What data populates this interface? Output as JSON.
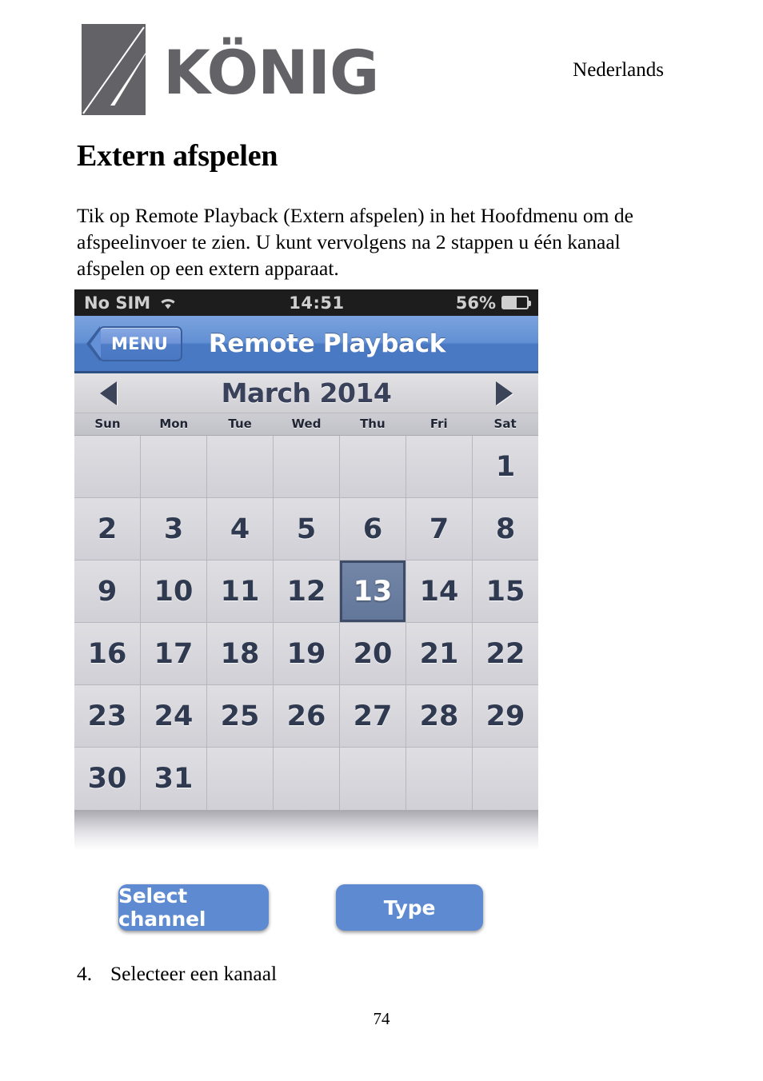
{
  "header": {
    "brand": "KÖNIG",
    "brand_icon": "konig-logo-mark",
    "language": "Nederlands"
  },
  "document": {
    "title": "Extern afspelen",
    "paragraph": "Tik op Remote Playback (Extern afspelen) in het Hoofdmenu om de afspeelinvoer te zien. U kunt vervolgens na 2 stappen u één kanaal afspelen op een extern apparaat.",
    "step": {
      "number": "4.",
      "text": "Selecteer een kanaal"
    },
    "page_number": "74"
  },
  "phone": {
    "status_bar": {
      "carrier": "No SIM",
      "wifi_icon": "wifi-icon",
      "time": "14:51",
      "battery_percent": "56%",
      "battery_icon": "battery-icon",
      "battery_level": 56
    },
    "nav_bar": {
      "back_label": "MENU",
      "title": "Remote Playback"
    },
    "calendar": {
      "prev_icon": "triangle-left-icon",
      "next_icon": "triangle-right-icon",
      "month_label": "March 2014",
      "weekdays": [
        "Sun",
        "Mon",
        "Tue",
        "Wed",
        "Thu",
        "Fri",
        "Sat"
      ],
      "selected_day": 13,
      "weeks": [
        [
          "",
          "",
          "",
          "",
          "",
          "",
          "1"
        ],
        [
          "2",
          "3",
          "4",
          "5",
          "6",
          "7",
          "8"
        ],
        [
          "9",
          "10",
          "11",
          "12",
          "13",
          "14",
          "15"
        ],
        [
          "16",
          "17",
          "18",
          "19",
          "20",
          "21",
          "22"
        ],
        [
          "23",
          "24",
          "25",
          "26",
          "27",
          "28",
          "29"
        ],
        [
          "30",
          "31",
          "",
          "",
          "",
          "",
          ""
        ]
      ]
    },
    "buttons": {
      "select_channel": "Select channel",
      "type": "Type"
    },
    "colors": {
      "nav_blue": "#4a79c4",
      "button_blue": "#5d8ad1",
      "selected_day_bg": "#62769a",
      "status_bar_bg": "#1d1d1d"
    }
  }
}
